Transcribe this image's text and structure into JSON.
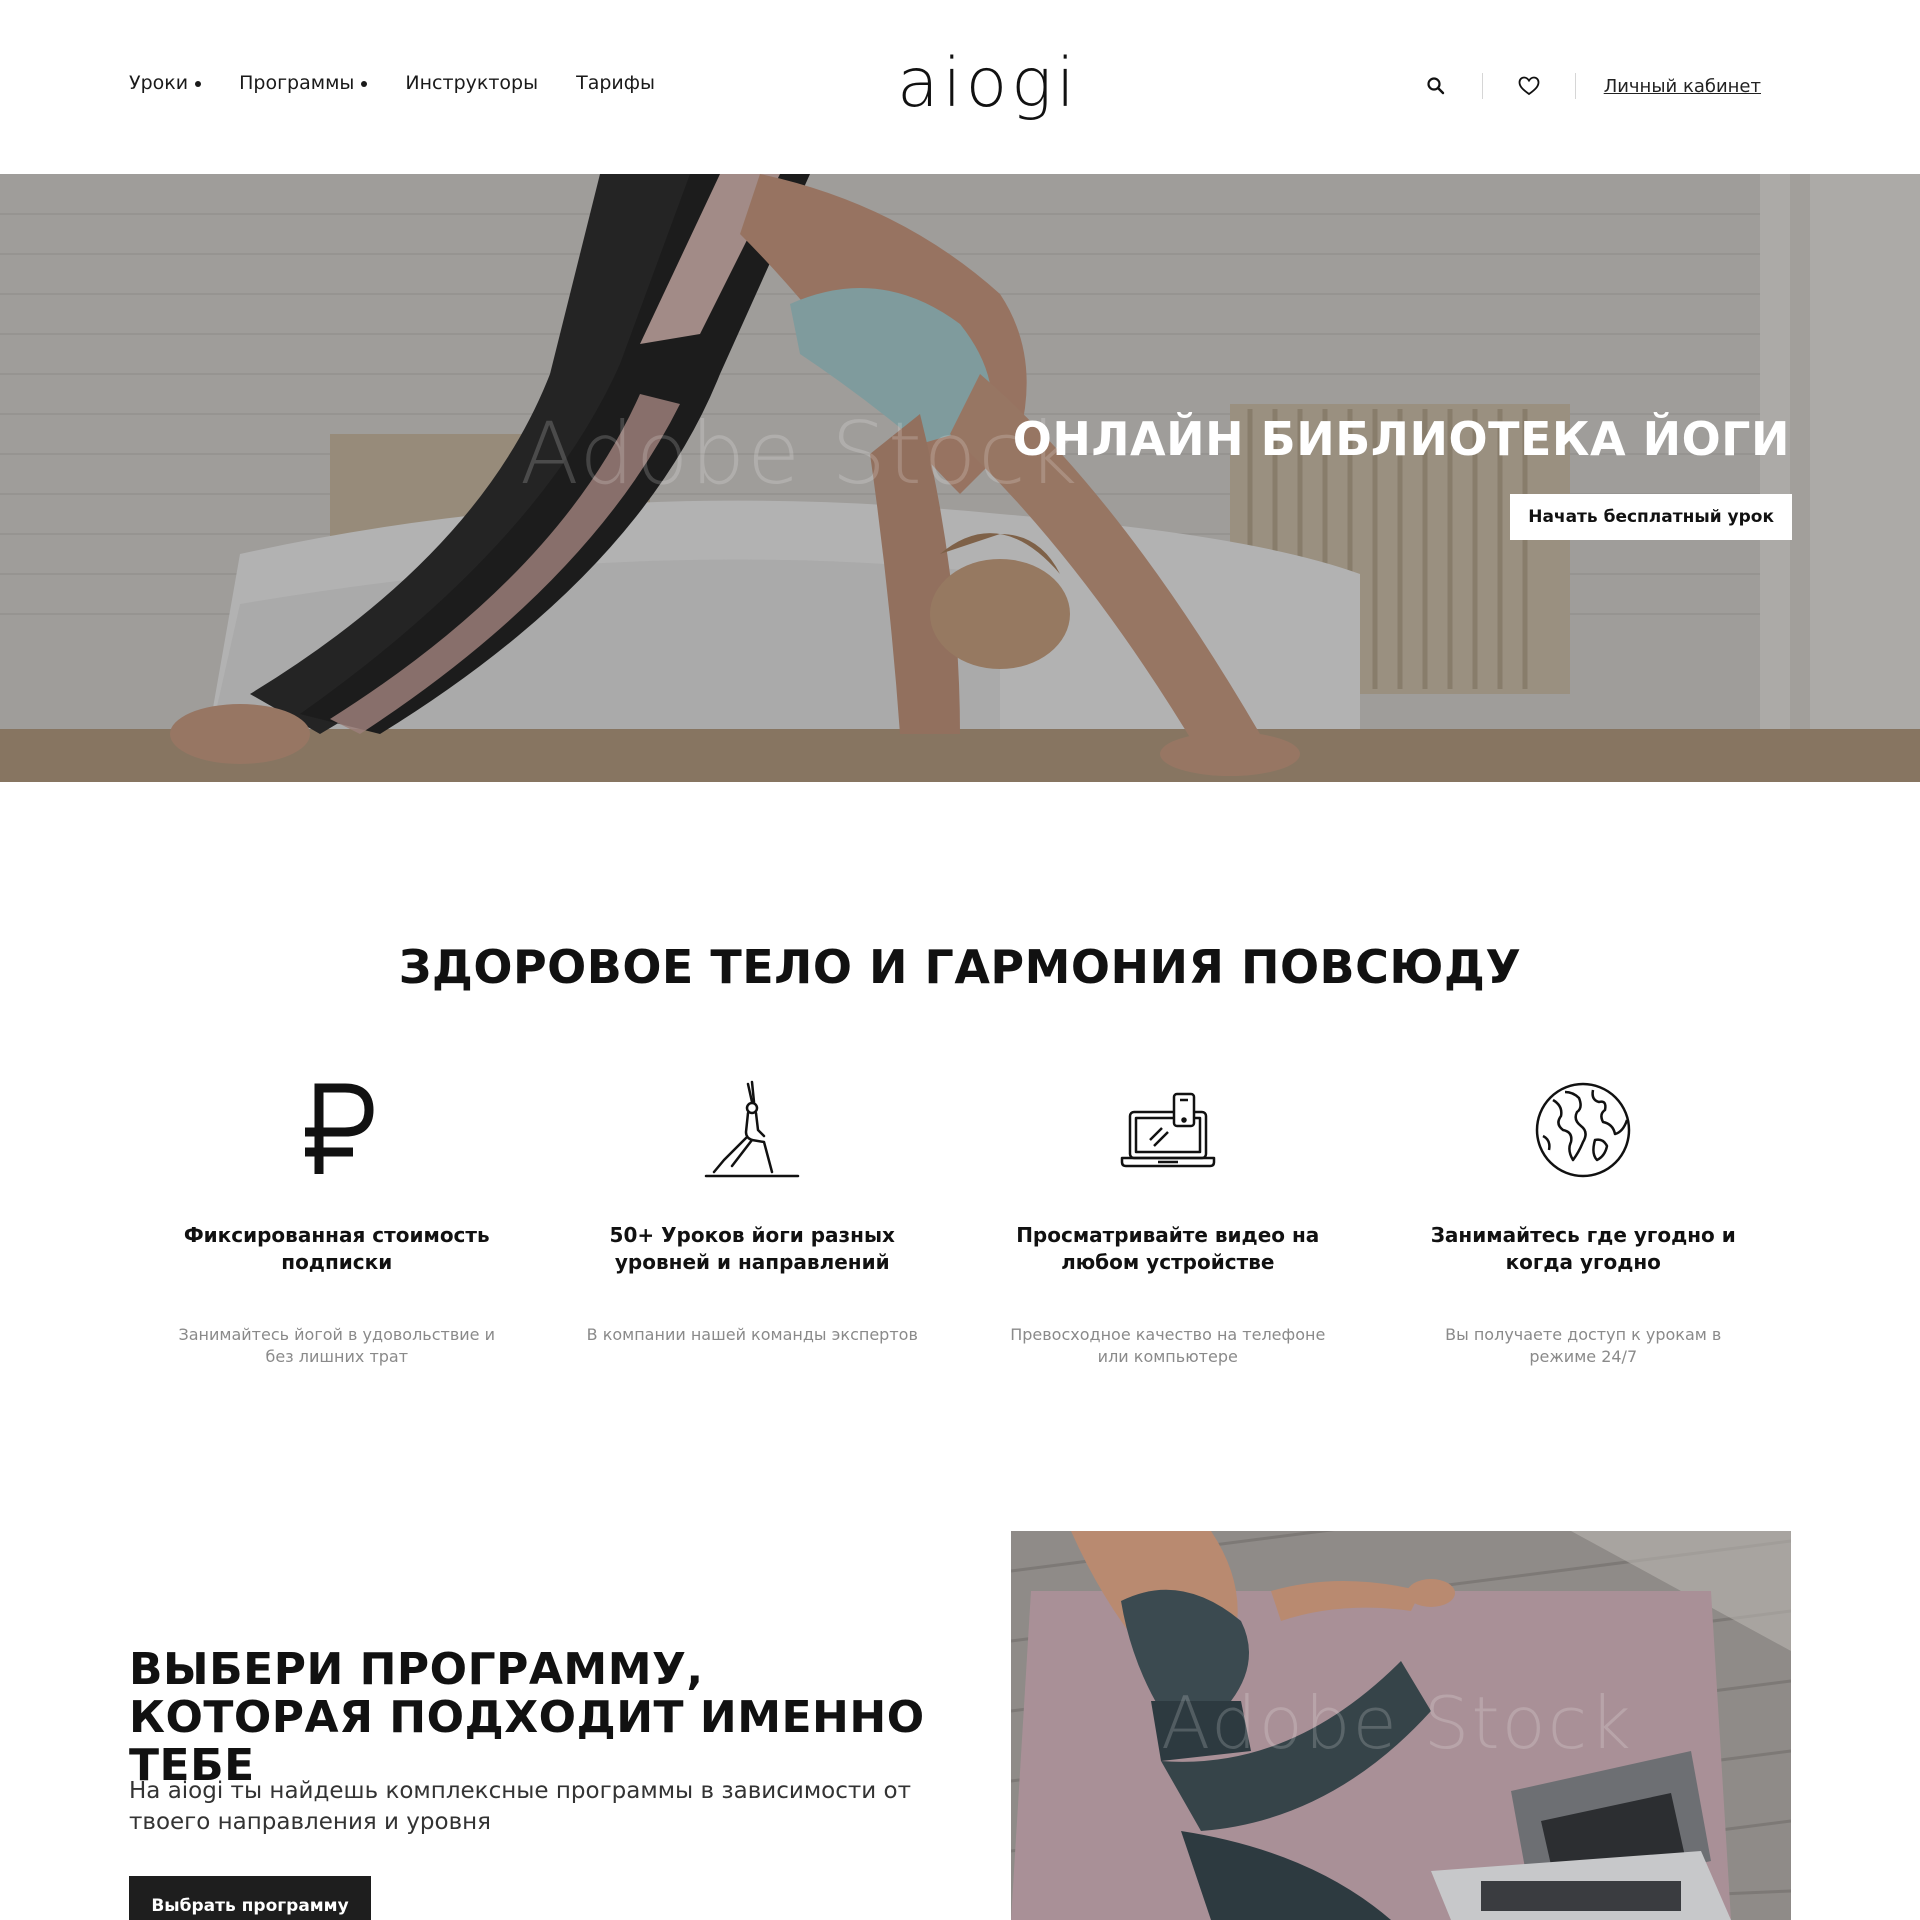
{
  "header": {
    "logo": "aiogi",
    "nav": [
      {
        "label": "Уроки",
        "has_dropdown": true
      },
      {
        "label": "Программы",
        "has_dropdown": true
      },
      {
        "label": "Инструкторы",
        "has_dropdown": false
      },
      {
        "label": "Тарифы",
        "has_dropdown": false
      }
    ],
    "icons": {
      "search": "search-icon",
      "favorites": "heart-icon"
    },
    "account_link": "Личный кабинет"
  },
  "hero": {
    "title": "ОНЛАЙН БИБЛИОТЕКА ЙОГИ",
    "button": "Начать бесплатный урок",
    "watermark": "Adobe Stock"
  },
  "features": {
    "title": "ЗДОРОВОЕ ТЕЛО И ГАРМОНИЯ ПОВСЮДУ",
    "items": [
      {
        "icon": "ruble-icon",
        "title": "Фиксированная стоимость подписки",
        "desc": "Занимайтесь йогой в удовольствие и без лишних трат"
      },
      {
        "icon": "yoga-pose-icon",
        "title": "50+ Уроков йоги разных уровней и направлений",
        "desc": "В компании нашей команды экспертов"
      },
      {
        "icon": "devices-icon",
        "title": "Просматривайте видео на любом устройстве",
        "desc": "Превосходное качество на телефоне или компьютере"
      },
      {
        "icon": "globe-icon",
        "title": "Занимайтесь где угодно и когда угодно",
        "desc": "Вы получаете доступ к урокам в режиме 24/7"
      }
    ]
  },
  "program": {
    "title": "ВЫБЕРИ ПРОГРАММУ, КОТОРАЯ ПОДХОДИТ ИМЕННО ТЕБЕ",
    "desc": "На aiogi ты найдешь комплексные программы в зависимости от твоего направления и уровня",
    "button": "Выбрать программу",
    "watermark": "Adobe Stock"
  },
  "colors": {
    "text": "#111111",
    "muted": "#8a8a8a",
    "button_dark": "#1e1e1e",
    "background": "#ffffff"
  }
}
